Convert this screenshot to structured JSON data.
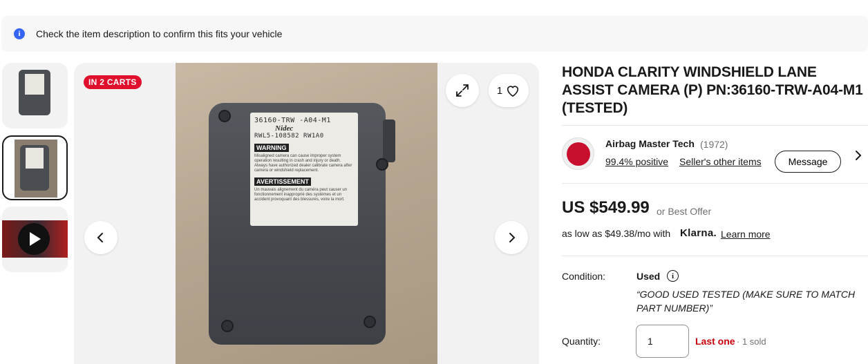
{
  "notice": {
    "icon": "info-icon",
    "message": "Check the item description to confirm this fits your vehicle"
  },
  "gallery": {
    "thumbnails": [
      {
        "kind": "image"
      },
      {
        "kind": "image",
        "selected": true
      },
      {
        "kind": "video",
        "icon": "play-icon"
      }
    ],
    "badge": "IN 2 CARTS",
    "watch_count": "1",
    "photo_label": {
      "part_number": "36160-TRW -A04-M1",
      "brand": "Nidec",
      "serial": "RWL5-108582  RW1A0",
      "warning": "WARNING",
      "warning_text": "Misaligned camera can cause improper system operation resulting in crash and injury or death. Always have authorized dealer calibrate camera after camera or windshield replacement.",
      "caution": "AVERTISSEMENT",
      "caution_text": "Un mauvais alignement du caméra peut causer un fonctionnement inapproprié des systèmes et un accident provoquant des blessures, voire la mort."
    }
  },
  "listing": {
    "title": "HONDA CLARITY WINDSHIELD LANE ASSIST CAMERA (P) PN:36160-TRW-A04-M1 (TESTED)",
    "seller": {
      "name": "Airbag Master Tech",
      "feedback_count": "(1972)",
      "positive": "99.4% positive",
      "other_items": "Seller's other items",
      "message_button": "Message"
    },
    "price": "US $549.99",
    "best_offer": "or Best Offer",
    "klarna_text": "as low as $49.38/mo with",
    "klarna_brand": "Klarna.",
    "learn_more": "Learn more",
    "condition_label": "Condition:",
    "condition": "Used",
    "condition_desc": "“GOOD USED TESTED (MAKE SURE TO MATCH PART NUMBER)”",
    "quantity_label": "Quantity:",
    "quantity_value": "1",
    "last_one": "Last one",
    "sold": "· 1 sold"
  },
  "colors": {
    "accent_blue": "#3665f3",
    "badge_red": "#e0102c",
    "last_one_red": "#c7000c"
  }
}
